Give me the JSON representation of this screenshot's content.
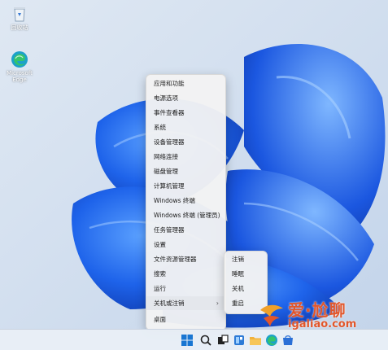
{
  "desktop": {
    "icons": [
      {
        "label": "回收站",
        "icon": "recycle-bin-icon"
      },
      {
        "label": "Microsoft Edge",
        "icon": "edge-icon"
      }
    ]
  },
  "context_menu": {
    "items": [
      {
        "label": "应用和功能"
      },
      {
        "label": "电源选项"
      },
      {
        "label": "事件查看器"
      },
      {
        "label": "系统"
      },
      {
        "label": "设备管理器"
      },
      {
        "label": "网络连接"
      },
      {
        "label": "磁盘管理"
      },
      {
        "label": "计算机管理"
      },
      {
        "label": "Windows 终端"
      },
      {
        "label": "Windows 终端 (管理员)"
      },
      {
        "label": "任务管理器"
      },
      {
        "label": "设置"
      },
      {
        "label": "文件资源管理器"
      },
      {
        "label": "搜索"
      },
      {
        "label": "运行"
      },
      {
        "label": "关机或注销"
      },
      {
        "label": "桌面"
      }
    ]
  },
  "shutdown_submenu": {
    "items": [
      {
        "label": "注销"
      },
      {
        "label": "睡眠"
      },
      {
        "label": "关机"
      },
      {
        "label": "重启"
      }
    ]
  },
  "taskbar": {
    "items": [
      "start-icon",
      "search-icon",
      "task-view-icon",
      "widgets-icon",
      "file-explorer-icon",
      "edge-icon",
      "store-icon"
    ]
  },
  "watermark": {
    "line1": "爱·尬聊",
    "line2": "igaliao.com"
  },
  "colors": {
    "wallpaper_bg": "#cfdcec",
    "bloom_blue": "#1a5ee8",
    "menu_bg": "#f3f3f3",
    "watermark": "#e2562a"
  }
}
